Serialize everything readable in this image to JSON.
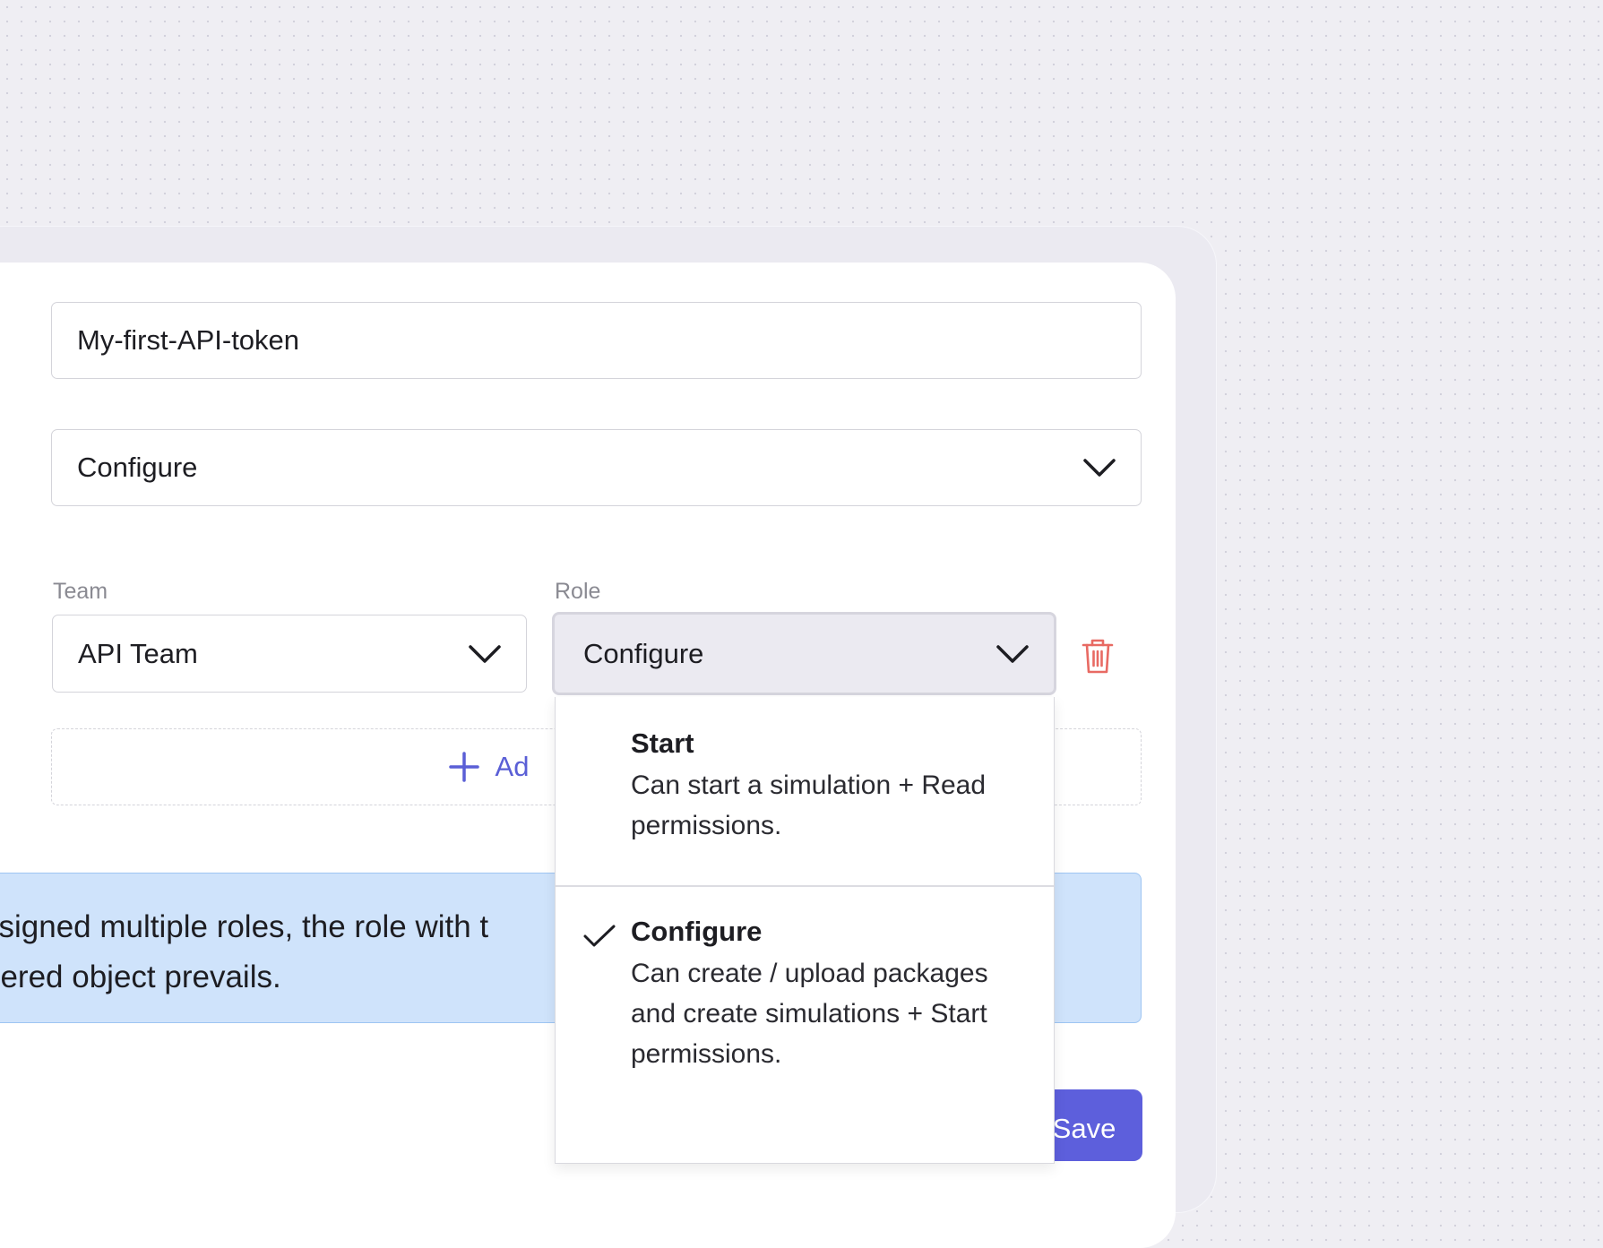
{
  "form": {
    "token_name_value": "My-first-API-token",
    "permission_select_value": "Configure",
    "team_label": "Team",
    "role_label": "Role",
    "team_select_value": "API Team",
    "role_select_value": "Configure",
    "add_row_label": "Ad",
    "save_label": "Save"
  },
  "info_banner": {
    "line1": "ssigned multiple roles, the role with t",
    "line2": "dered object prevails."
  },
  "role_dropdown": {
    "options": [
      {
        "name": "Start",
        "description": "Can start a simulation + Read permissions.",
        "selected": false
      },
      {
        "name": "Configure",
        "description": "Can create / upload packages and create simulations + Start permissions.",
        "selected": true
      }
    ]
  },
  "colors": {
    "accent": "#5d5fdc",
    "danger": "#e86a63",
    "info_bg": "#cfe3fb"
  },
  "icons": [
    "chevron-down-icon",
    "trash-icon",
    "plus-icon",
    "check-icon"
  ]
}
